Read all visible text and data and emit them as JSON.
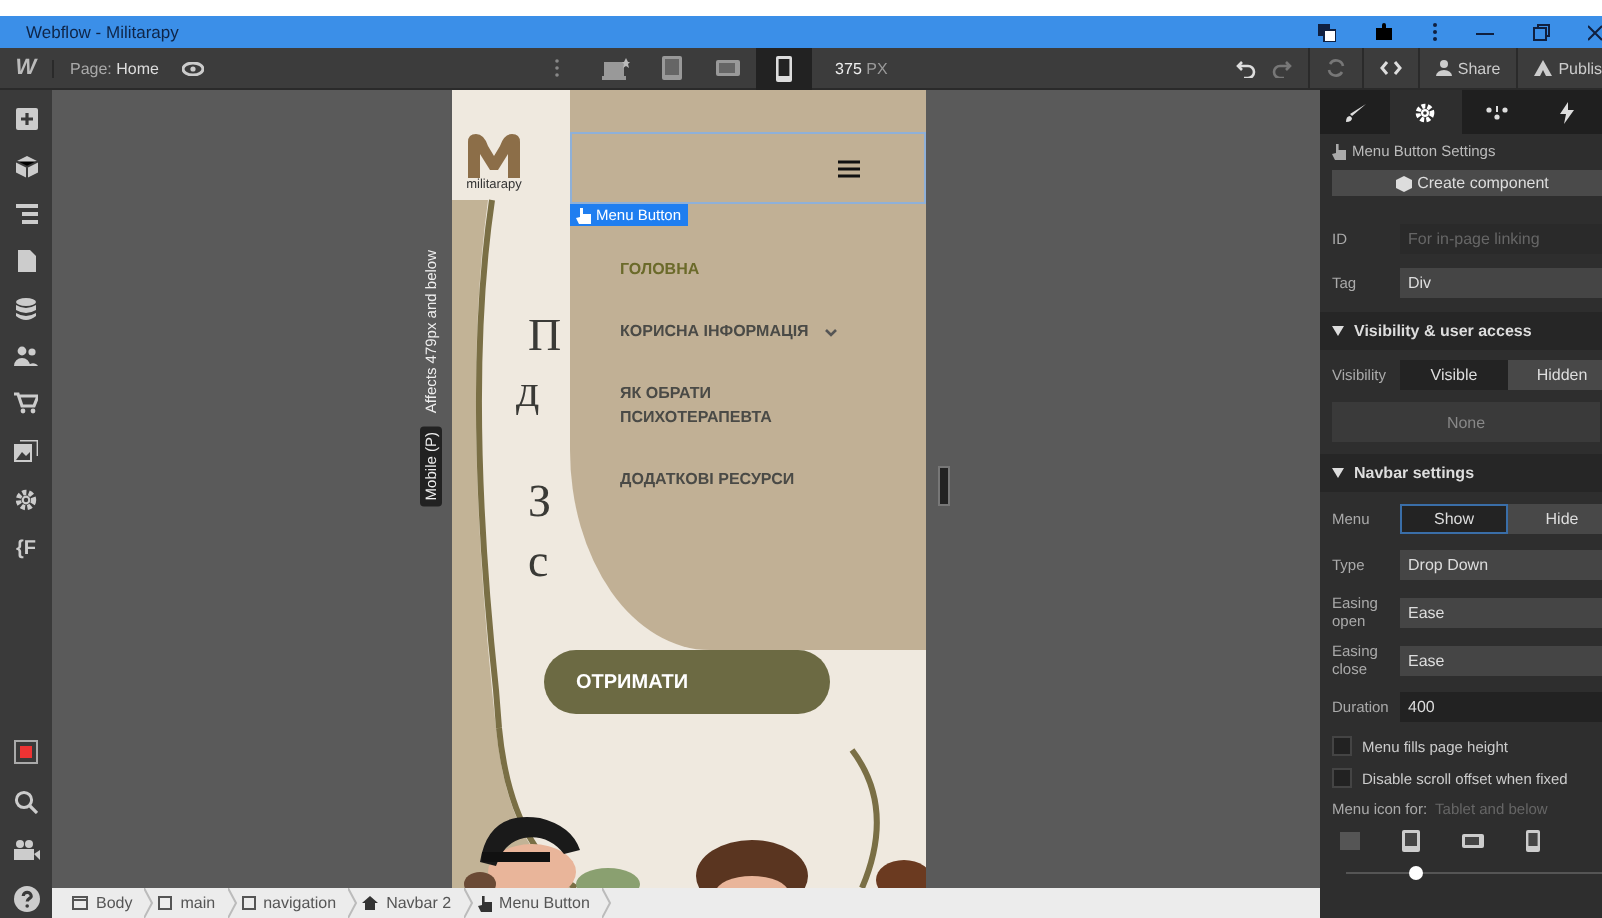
{
  "window": {
    "title": "Webflow - Militarapy"
  },
  "toolbar": {
    "logo": "W",
    "page_label": "Page:",
    "page_name": "Home",
    "devices": [
      {
        "kind": "desktop",
        "selected": false
      },
      {
        "kind": "tablet",
        "selected": false
      },
      {
        "kind": "landscape",
        "selected": false
      },
      {
        "kind": "phone",
        "selected": true
      }
    ],
    "width_value": "375",
    "width_unit": "PX",
    "share": "Share",
    "publish": "Publis"
  },
  "left_sidebar": {
    "extension_label": "{F"
  },
  "canvas": {
    "breakpoint_note": "Affects 479px and below",
    "breakpoint_badge": "Mobile (P)",
    "selection_label": "Menu Button",
    "logo_text": "militarapy",
    "hero_fragments": [
      "П",
      "д",
      "З",
      "с"
    ],
    "cta_text": "ОТРИМАТИ",
    "menu_items": [
      {
        "label": "ГОЛОВНА",
        "selected": true,
        "has_dropdown": false
      },
      {
        "label": "КОРИСНА ІНФОРМАЦІЯ",
        "selected": false,
        "has_dropdown": true
      },
      {
        "label": "ЯК ОБРАТИ ПСИХОТЕРАПЕВТА",
        "selected": false,
        "has_dropdown": false
      },
      {
        "label": "ДОДАТКОВІ РЕСУРСИ",
        "selected": false,
        "has_dropdown": false
      }
    ]
  },
  "breadcrumbs": [
    {
      "label": "Body",
      "kind": "body"
    },
    {
      "label": "main",
      "kind": "div"
    },
    {
      "label": "navigation",
      "kind": "div"
    },
    {
      "label": "Navbar 2",
      "kind": "navbar"
    },
    {
      "label": "Menu Button",
      "kind": "menu-button"
    }
  ],
  "panel": {
    "tabs": [
      {
        "kind": "style",
        "selected": false
      },
      {
        "kind": "settings",
        "selected": true
      },
      {
        "kind": "interactions",
        "selected": false
      },
      {
        "kind": "effects",
        "selected": false
      }
    ],
    "heading": "Menu Button Settings",
    "create_button": "Create component",
    "id_field": {
      "label": "ID",
      "placeholder": "For in-page linking"
    },
    "tag_field": {
      "label": "Tag",
      "value": "Div"
    },
    "visibility_section": {
      "title": "Visibility & user access",
      "expanded": true
    },
    "visibility": {
      "label": "Visibility",
      "options": [
        {
          "label": "Visible",
          "selected": true
        },
        {
          "label": "Hidden",
          "selected": false
        }
      ],
      "conditions": "None"
    },
    "navbar_section": {
      "title": "Navbar settings",
      "expanded": true
    },
    "menu": {
      "label": "Menu",
      "options": [
        {
          "label": "Show",
          "selected": true
        },
        {
          "label": "Hide",
          "selected": false
        }
      ]
    },
    "selects": [
      {
        "label": "Type",
        "value": "Drop Down"
      },
      {
        "label": "Easing open",
        "value": "Ease"
      },
      {
        "label": "Easing close",
        "value": "Ease"
      }
    ],
    "duration": {
      "label": "Duration",
      "value": "400"
    },
    "checkboxes": [
      {
        "label": "Menu fills page height",
        "checked": false
      },
      {
        "label": "Disable scroll offset when fixed",
        "checked": false
      }
    ],
    "menu_icon": {
      "label": "Menu icon for:",
      "value": "Tablet and below",
      "level": 0.27
    }
  }
}
